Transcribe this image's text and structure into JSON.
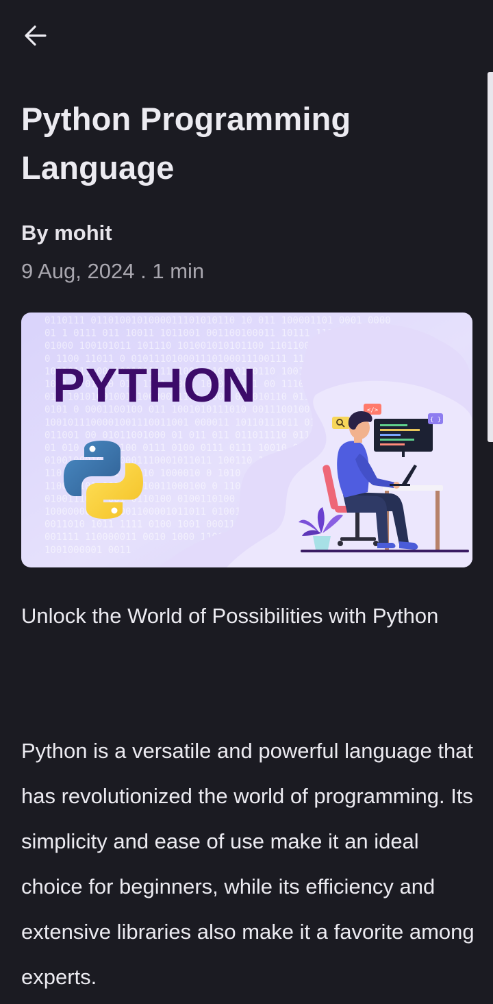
{
  "article": {
    "title": "Python Programming Language",
    "author": "By mohit",
    "date": "9 Aug, 2024",
    "separator": " . ",
    "read_time": "1 min",
    "subtitle": "Unlock the World of Possibilities with Python",
    "body": "Python is a versatile and powerful language that has revolutionized the world of programming. Its simplicity and ease of use make it an ideal choice for beginners, while its efficiency and extensive libraries also make it a favorite among experts."
  },
  "hero": {
    "wordmark": "PYTHON",
    "code_tag": "</>",
    "brace_tag": "{ }",
    "binary_rows": [
      "0110111 0110100101000011101010110 10 011 100001101 0001 0000",
      "01 1 0111 011 10011 1011001 001100100011 10111 111 00 01000",
      "01000 100101011 101110 101001010101100 1101100 10001 10000",
      "0 1100 11011 0 010111010001110100011100111 11100111001",
      "10010111 00 1001001111 1001 1100 0110110 10011 1100 1011",
      "1011 0 01010 011 1101 1001 10100 0111 00 1110 010 0110",
      "011 10101001001010000011101 1001 000010110 0111 1001",
      "0101 0 0001100100 011 1001010111010 001110010011 10",
      "1001011100001001110011001 000011 10110111011 0111",
      "011001 00 01011001000 01 011 011 011011110 011",
      "01 010 011 01100 0111 0100 0111 0111 10010 01101",
      "01001000100110001110001011011 100110 10100 1",
      "110 000 10001 01010 1000010 0 1010 0110 1 010",
      "110000101 001001010011000100 0 11010100 110",
      "0100111011 001 0110100 0100110100 01011 01",
      "1000000011001001100001011011 0100110100",
      "0011010 1011 1111 0100 1001 00011010",
      "001111 110000011 0010 1000 1100",
      "1001000001 0011"
    ]
  }
}
